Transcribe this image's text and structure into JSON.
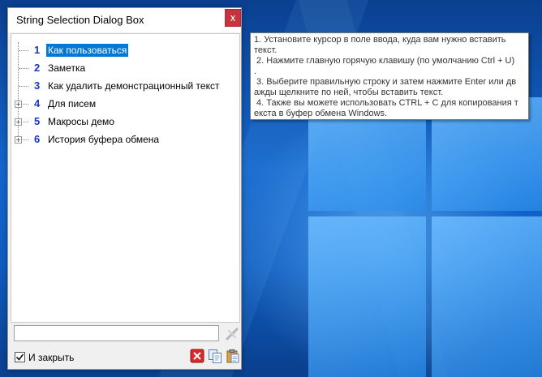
{
  "dialog": {
    "title": "String Selection Dialog Box",
    "close_label": "x",
    "items": [
      {
        "num": "1",
        "label": "Как пользоваться",
        "expandable": false,
        "selected": true
      },
      {
        "num": "2",
        "label": "Заметка",
        "expandable": false,
        "selected": false
      },
      {
        "num": "3",
        "label": "Как удалить демонстрационный текст",
        "expandable": false,
        "selected": false
      },
      {
        "num": "4",
        "label": "Для писем",
        "expandable": true,
        "selected": false
      },
      {
        "num": "5",
        "label": "Макросы демо",
        "expandable": true,
        "selected": false
      },
      {
        "num": "6",
        "label": "История буфера обмена",
        "expandable": true,
        "selected": false
      }
    ],
    "input_value": "",
    "close_checkbox_label": "И закрыть",
    "close_checkbox_checked": true
  },
  "tooltip": {
    "lines": [
      "1. Установите курсор в поле ввода, куда вам нужно вставить",
      "текст.",
      " 2. Нажмите главную горячую клавишу (по умолчанию Ctrl + U)",
      ".",
      " 3. Выберите правильную строку и затем нажмите Enter или дв",
      "ажды щелкните по ней, чтобы вставить текст.",
      " 4. Также вы можете использовать CTRL + C для копирования т",
      "екста в буфер обмена Windows."
    ]
  },
  "icons": {
    "clear": "clear-input-icon",
    "delete": "delete-icon",
    "copy": "copy-icon",
    "paste": "paste-icon"
  },
  "colors": {
    "selection": "#0078d7",
    "number": "#1a34c6",
    "close_button": "#c8323c"
  }
}
